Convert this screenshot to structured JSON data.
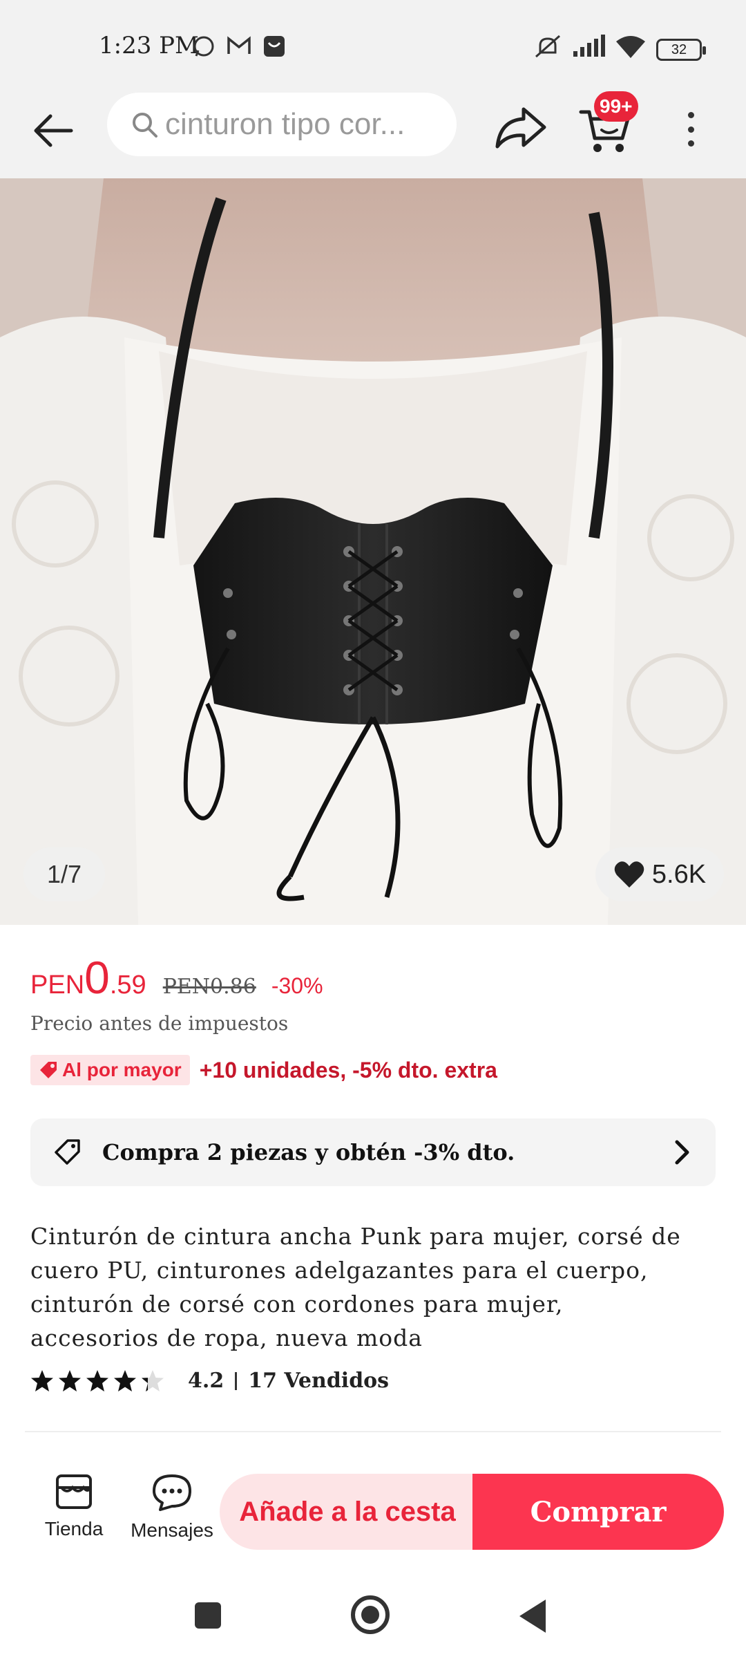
{
  "status_bar": {
    "time": "1:23 PM",
    "battery": "32",
    "icons": [
      "whatsapp-icon",
      "gmail-icon",
      "notification-icon",
      "mute-icon",
      "signal-icon",
      "wifi-icon",
      "battery-icon"
    ]
  },
  "header": {
    "search_text": "cinturon tipo cor...",
    "cart_badge": "99+",
    "icons": [
      "back-arrow-icon",
      "search-icon",
      "share-icon",
      "cart-icon",
      "more-icon"
    ]
  },
  "gallery": {
    "counter": "1/7",
    "likes": "5.6K"
  },
  "price": {
    "currency": "PEN",
    "integer": "0",
    "decimal": ".59",
    "old_price": "PEN0.86",
    "discount": "-30%",
    "tax_note": "Precio antes de impuestos"
  },
  "wholesale": {
    "tag": "Al por mayor",
    "text": "+10 unidades, -5% dto. extra"
  },
  "promo": {
    "text": "Compra 2 piezas y obtén -3% dto."
  },
  "product": {
    "title": "Cinturón de cintura ancha Punk para mujer, corsé de cuero PU, cinturones adelgazantes para el cuerpo, cinturón de corsé con cordones para mujer, accesorios de ropa, nueva moda",
    "rating": "4.2",
    "rating_fraction": 0.84,
    "sold": "17 Vendidos"
  },
  "bottom_bar": {
    "store_label": "Tienda",
    "messages_label": "Mensajes",
    "add_to_cart": "Añade a la cesta",
    "buy": "Comprar"
  },
  "colors": {
    "accent": "#e8243a",
    "buy_button": "#fc3550",
    "cart_button_bg": "#fde4e6"
  }
}
